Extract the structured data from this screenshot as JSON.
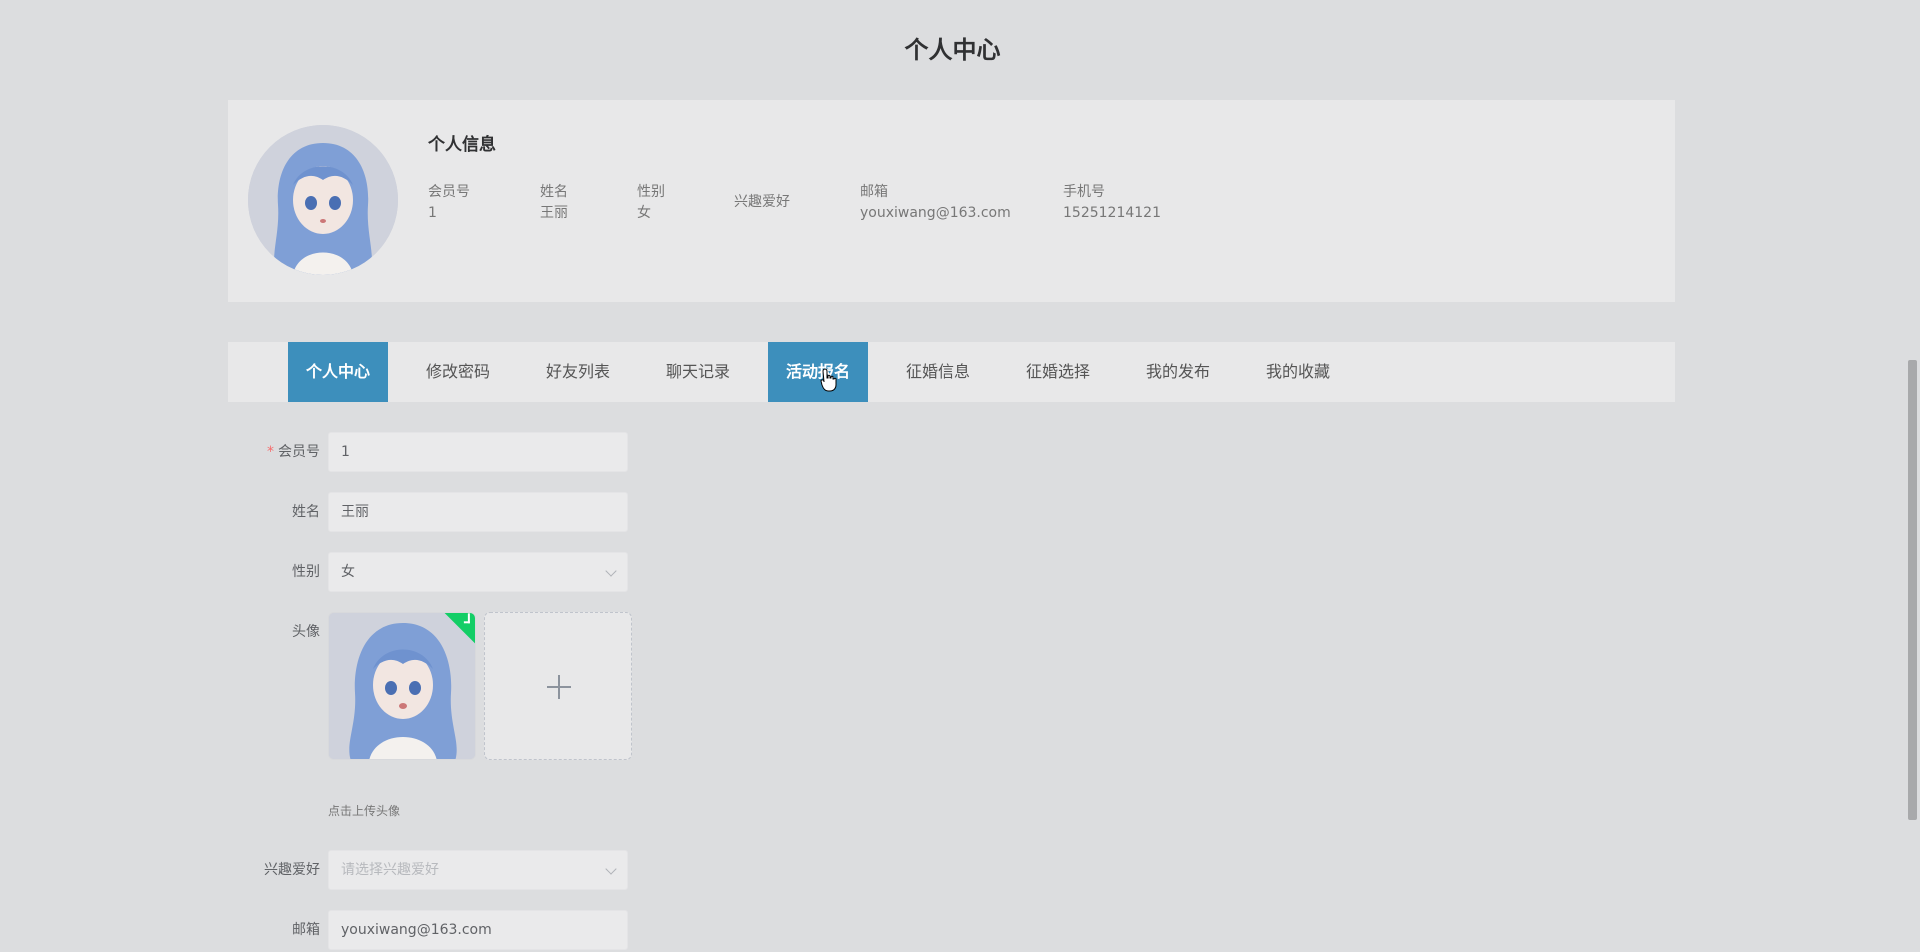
{
  "page": {
    "title": "个人中心"
  },
  "profile": {
    "heading": "个人信息",
    "fields": [
      {
        "label": "会员号",
        "value": "1"
      },
      {
        "label": "姓名",
        "value": "王丽"
      },
      {
        "label": "性别",
        "value": "女"
      },
      {
        "label": "兴趣爱好",
        "value": ""
      },
      {
        "label": "邮箱",
        "value": "youxiwang@163.com"
      },
      {
        "label": "手机号",
        "value": "15251214121"
      }
    ]
  },
  "tabs": [
    {
      "label": "个人中心",
      "active": true
    },
    {
      "label": "修改密码",
      "active": false
    },
    {
      "label": "好友列表",
      "active": false
    },
    {
      "label": "聊天记录",
      "active": false
    },
    {
      "label": "活动报名",
      "active": true
    },
    {
      "label": "征婚信息",
      "active": false
    },
    {
      "label": "征婚选择",
      "active": false
    },
    {
      "label": "我的发布",
      "active": false
    },
    {
      "label": "我的收藏",
      "active": false
    }
  ],
  "form": {
    "member_no": {
      "label": "会员号",
      "required_mark": "*",
      "value": "1"
    },
    "name": {
      "label": "姓名",
      "value": "王丽"
    },
    "gender": {
      "label": "性别",
      "value": "女"
    },
    "avatar": {
      "label": "头像",
      "tip": "点击上传头像"
    },
    "hobby": {
      "label": "兴趣爱好",
      "placeholder": "请选择兴趣爱好"
    },
    "email": {
      "label": "邮箱",
      "value": "youxiwang@163.com"
    }
  },
  "colors": {
    "accent": "#3d8fbc",
    "background": "#dcdddf",
    "card": "#e8e8e9",
    "success": "#13ce66",
    "required": "#f56c6c"
  },
  "icons": [
    "chevron-down-icon",
    "plus-icon",
    "check-icon",
    "hand-cursor-icon"
  ]
}
